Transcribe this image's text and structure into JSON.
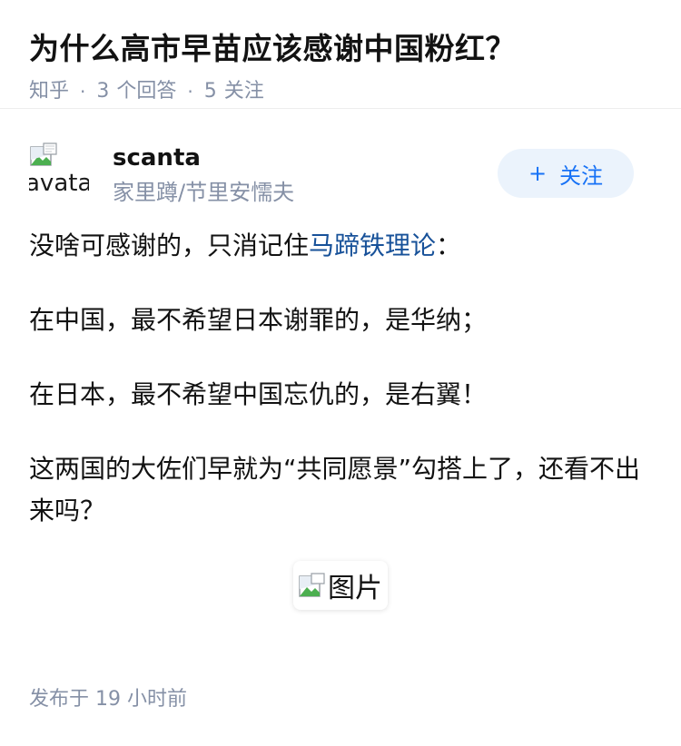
{
  "question": {
    "title": "为什么高市早苗应该感谢中国粉红？",
    "source": "知乎",
    "dot": "·",
    "answer_count": "3",
    "answer_label": "个回答",
    "follower_count": "5",
    "follower_label": "关注"
  },
  "author": {
    "avatar_alt": "avatar",
    "name": "scanta",
    "headline": "家里蹲/节里安懦夫",
    "follow_label": "关注",
    "follow_icon": "+"
  },
  "answer": {
    "p1_text": "没啥可感谢的，只消记住",
    "p1_link": "马蹄铁理论",
    "p1_end": "：",
    "p2": "在中国，最不希望日本谢罪的，是华纳；",
    "p3": "在日本，最不希望中国忘仇的，是右翼！",
    "p4": "这两国的大佐们早就为“共同愿景”勾搭上了，还看不出来吗？",
    "image_alt": "图片",
    "published": "发布于 19 小时前"
  },
  "colors": {
    "link": "#175199",
    "meta": "#8590a6",
    "follow_bg": "#ebf3fc",
    "follow_text": "#1772f6"
  }
}
